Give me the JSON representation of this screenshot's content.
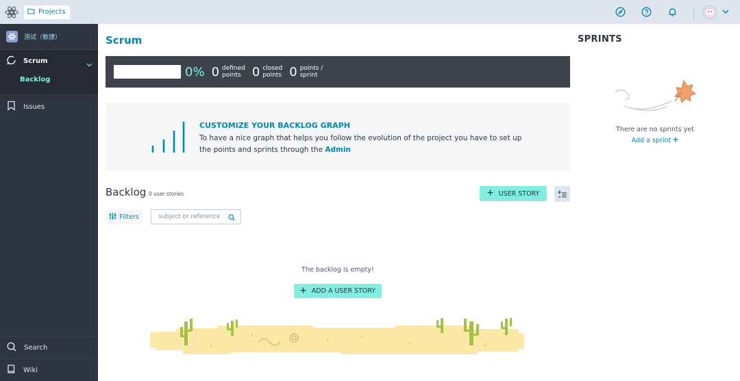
{
  "topbar": {
    "projects_label": "Projects",
    "icons": [
      "logo-icon",
      "compass-icon",
      "help-icon",
      "bell-icon",
      "chevron-down-icon"
    ]
  },
  "sidebar": {
    "project_name": "测试（敏捷）",
    "scrum_label": "Scrum",
    "backlog_label": "Backlog",
    "issues_label": "Issues",
    "search_label": "Search",
    "wiki_label": "Wiki"
  },
  "main": {
    "title": "Scrum",
    "summary": {
      "percent": "0%",
      "defined_value": "0",
      "defined_label_1": "defined",
      "defined_label_2": "points",
      "closed_value": "0",
      "closed_label_1": "closed",
      "closed_label_2": "points",
      "sprint_value": "0",
      "sprint_label_1": "points /",
      "sprint_label_2": "sprint"
    },
    "graph": {
      "title": "CUSTOMIZE YOUR BACKLOG GRAPH",
      "text": "To have a nice graph that helps you follow the evolution of the project you have to set up the points and sprints through the",
      "link": "Admin"
    },
    "backlog": {
      "title": "Backlog",
      "count": "0 user stories",
      "user_story_button": "USER STORY",
      "filters_label": "Filters",
      "search_placeholder": "subject or reference",
      "empty_text": "The backlog is empty!",
      "add_button": "ADD A USER STORY"
    }
  },
  "sprints": {
    "title": "SPRINTS",
    "empty_text": "There are no sprints yet",
    "add_link": "Add a sprint"
  },
  "colors": {
    "accent": "#008aa8",
    "mint": "#83ede0",
    "sidebar": "#2e3440",
    "topbar": "#dfe5ee"
  }
}
